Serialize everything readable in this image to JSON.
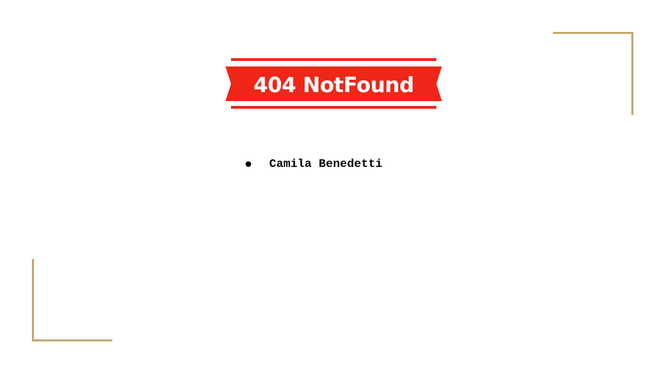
{
  "logo": {
    "text": "404 NotFound",
    "banner_color": "#ee2718",
    "text_color": "#ffffff"
  },
  "bullets": [
    "Camila Benedetti"
  ],
  "decor": {
    "corner_color": "#c9a772"
  }
}
